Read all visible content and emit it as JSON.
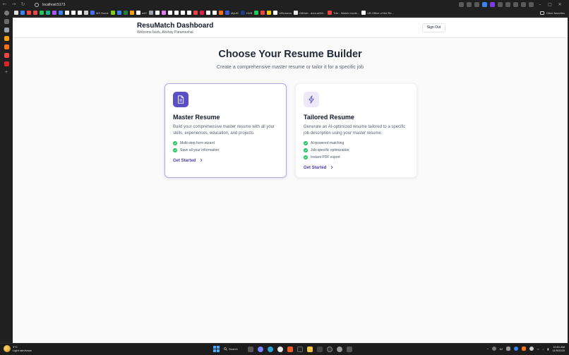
{
  "browser": {
    "url": "localhost:5173",
    "bookmarks": [
      {
        "label": "",
        "color": "#e0e0e0"
      },
      {
        "label": "",
        "color": "#3b82f6"
      },
      {
        "label": "",
        "color": "#ef4444"
      },
      {
        "label": "",
        "color": "#ef4444"
      },
      {
        "label": "",
        "color": "#22c55e"
      },
      {
        "label": "",
        "color": "#10b981"
      },
      {
        "label": "",
        "color": "#a855f7"
      },
      {
        "label": "",
        "color": "#3b82f6"
      },
      {
        "label": "",
        "color": "#ffffff"
      },
      {
        "label": "",
        "color": "#ffffff"
      },
      {
        "label": "",
        "color": "#ffffff"
      },
      {
        "label": "",
        "color": "#d0d0d0"
      },
      {
        "label": "MS Home",
        "color": "#4f6bed"
      },
      {
        "label": "",
        "color": "#84cc16"
      },
      {
        "label": "",
        "color": "#3b82f6"
      },
      {
        "label": "",
        "color": "#1e7f3f"
      },
      {
        "label": "",
        "color": "#f59e0b"
      },
      {
        "label": "edX",
        "color": "#ffffff"
      },
      {
        "label": "",
        "color": "#9ca3af"
      },
      {
        "label": "",
        "color": "#ffffff"
      },
      {
        "label": "",
        "color": "#e879f9"
      },
      {
        "label": "",
        "color": "#ffffff"
      },
      {
        "label": "",
        "color": "#ffffff"
      },
      {
        "label": "",
        "color": "#ffffff"
      },
      {
        "label": "",
        "color": "#ffffff"
      },
      {
        "label": "",
        "color": "#ef4444"
      },
      {
        "label": "",
        "color": "#e11d48"
      },
      {
        "label": "",
        "color": "#ffffff"
      },
      {
        "label": "",
        "color": "#ffffff"
      },
      {
        "label": "",
        "color": "#f97316"
      },
      {
        "label": "MyUB",
        "color": "#3b5bdb"
      },
      {
        "label": "HUB",
        "color": "#1e3a8a"
      },
      {
        "label": "",
        "color": "#22c55e"
      },
      {
        "label": "",
        "color": "#ef4444"
      },
      {
        "label": "",
        "color": "#facc15"
      },
      {
        "label": "UBLearns",
        "color": "#ffffff"
      },
      {
        "label": "GitHub - dom-ai/Mi...",
        "color": "#e5e7eb"
      },
      {
        "label": "Trlix - Watch movie...",
        "color": "#ef4444"
      },
      {
        "label": "UB Office of the Re...",
        "color": "#ffffff"
      }
    ],
    "other_favorites": "Other favorites"
  },
  "app": {
    "title": "ResuMatch Dashboard",
    "welcome": "Welcome back, Akshay Parameshal",
    "sign_out": "Sign Out"
  },
  "hero": {
    "title": "Choose Your Resume Builder",
    "subtitle": "Create a comprehensive master resume or tailor it for a specific job"
  },
  "cards": {
    "master": {
      "icon": "document-icon",
      "title": "Master Resume",
      "description": "Build your comprehensive master resume with all your skills, experiences, education, and projects.",
      "features": [
        "Multi-step form wizard",
        "Save all your information"
      ],
      "cta": "Get Started"
    },
    "tailored": {
      "icon": "lightning-icon",
      "title": "Tailored Resume",
      "description": "Generate an AI-optimized resume tailored to a specific job description using your master resume.",
      "features": [
        "AI-powered matching",
        "Job-specific optimization",
        "Instant PDF export"
      ],
      "cta": "Get Started"
    }
  },
  "colors": {
    "accent": "#5b4fc4",
    "cta": "#4c3fa8",
    "check": "#22c55e"
  },
  "taskbar": {
    "weather_temp": "3°C",
    "weather_desc": "Light rain/snow",
    "search_label": "Search",
    "tray_number": "62",
    "time": "10:51 AM",
    "date": "11/9/2025"
  }
}
